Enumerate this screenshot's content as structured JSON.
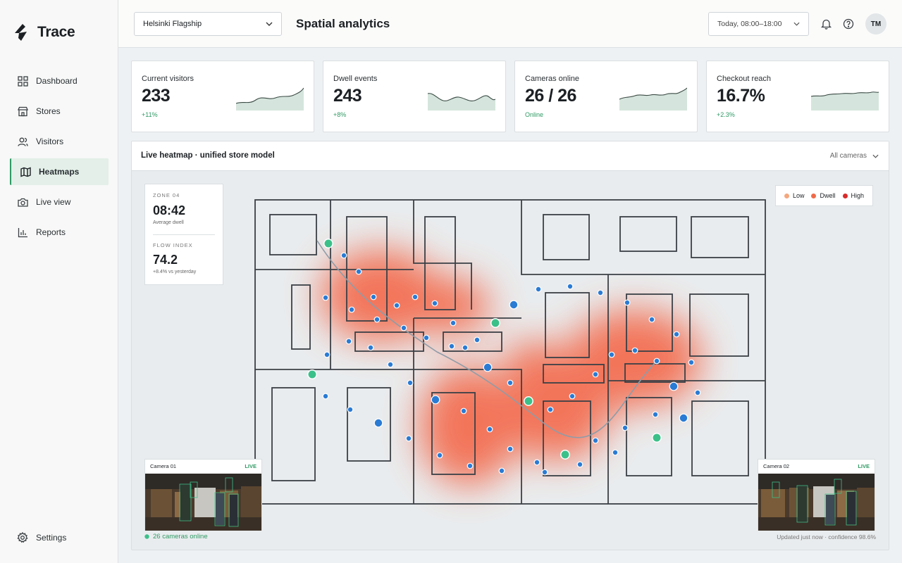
{
  "app": {
    "name": "Trace"
  },
  "sidebar": {
    "items": [
      {
        "label": "Dashboard",
        "icon": "dashboard-icon"
      },
      {
        "label": "Stores",
        "icon": "store-icon"
      },
      {
        "label": "Visitors",
        "icon": "users-icon"
      },
      {
        "label": "Heatmaps",
        "icon": "map-icon",
        "active": true
      },
      {
        "label": "Live view",
        "icon": "camera-icon"
      },
      {
        "label": "Reports",
        "icon": "bar-chart-icon"
      }
    ],
    "settings_label": "Settings"
  },
  "header": {
    "store": "Helsinki Flagship",
    "title": "Spatial analytics",
    "date_range": "Today, 08:00–18:00",
    "avatar": "TM"
  },
  "kpis": [
    {
      "label": "Current visitors",
      "value": "233",
      "delta": "+11%"
    },
    {
      "label": "Dwell events",
      "value": "243",
      "delta": "+8%"
    },
    {
      "label": "Cameras online",
      "value": "26 / 26",
      "delta": "Online"
    },
    {
      "label": "Checkout reach",
      "value": "16.7%",
      "delta": "+2.3%"
    }
  ],
  "panel": {
    "title": "Live heatmap · unified store model",
    "filter": "All cameras"
  },
  "zone_card": {
    "zone_label": "ZONE 04",
    "dwell_value": "08:42",
    "dwell_sub": "Average dwell",
    "flow_label": "FLOW INDEX",
    "flow_value": "74.2",
    "flow_sub": "+8.4% vs yesterday"
  },
  "legend": [
    {
      "label": "Low",
      "color": "#f5a77e"
    },
    {
      "label": "Dwell",
      "color": "#f06a4a"
    },
    {
      "label": "High",
      "color": "#d92b2b"
    }
  ],
  "cameras": [
    {
      "name": "Camera 01",
      "status": "LIVE"
    },
    {
      "name": "Camera 02",
      "status": "LIVE"
    }
  ],
  "footer": {
    "cameras_online": "26 cameras online",
    "updated": "Updated just now · confidence 98.6%"
  },
  "colors": {
    "accent": "#2f9a64",
    "visitor": "#2a7bd4",
    "staff": "#3cc08a",
    "heat": "#f4603f"
  }
}
